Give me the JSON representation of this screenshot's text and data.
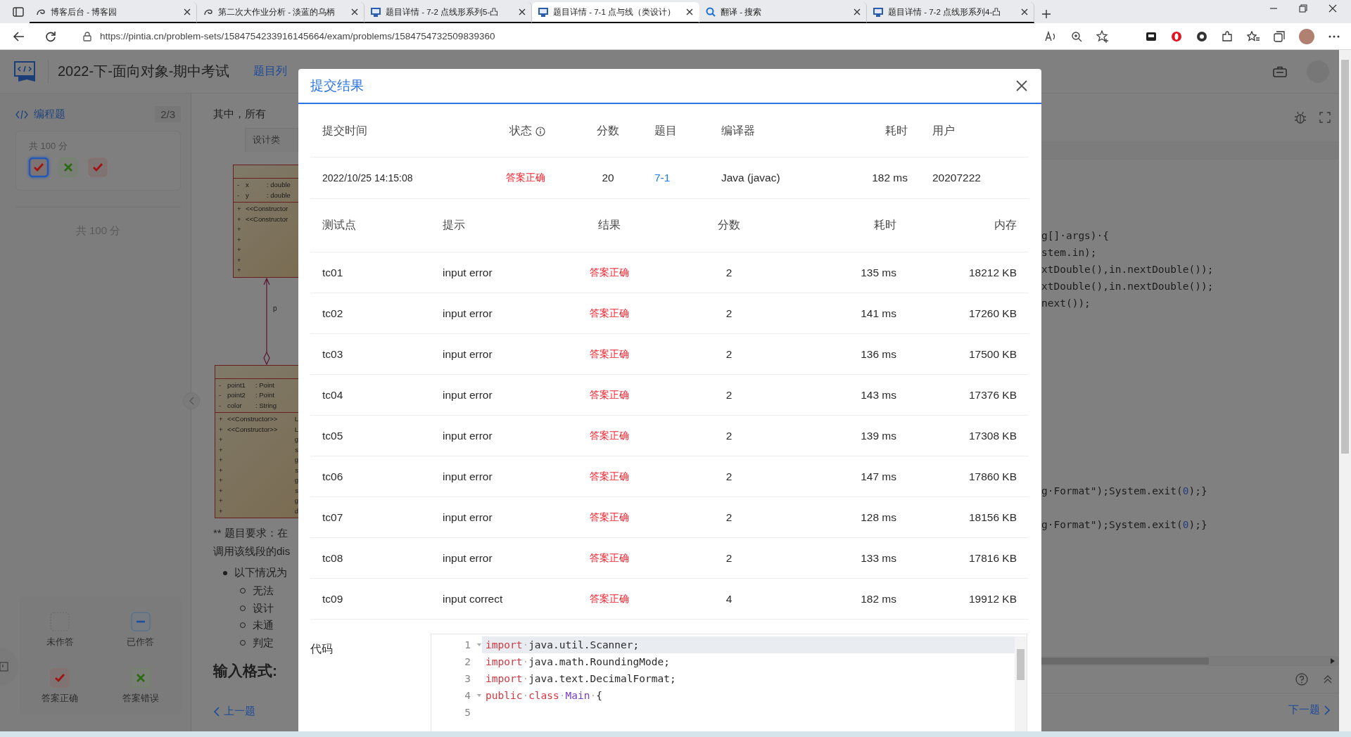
{
  "browser": {
    "tabs": [
      {
        "title": "博客后台 - 博客园",
        "kind": "blog",
        "selected": false
      },
      {
        "title": "第二次大作业分析 - 淡蓝的乌柄",
        "kind": "blog",
        "selected": false
      },
      {
        "title": "题目详情 - 7-2 点线形系列5-凸",
        "kind": "pta",
        "selected": false
      },
      {
        "title": "题目详情 - 7-1 点与线（类设计）",
        "kind": "pta",
        "selected": true
      },
      {
        "title": "翻译 - 搜索",
        "kind": "search",
        "selected": false
      },
      {
        "title": "题目详情 - 7-2 点线形系列4-凸",
        "kind": "pta",
        "selected": false
      }
    ],
    "url": "https://pintia.cn/problem-sets/1584754233916145664/exam/problems/1584754732509839360"
  },
  "header": {
    "title": "2022-下-面向对象-期中考试",
    "nav": [
      {
        "label": "题目列",
        "selected": true
      }
    ]
  },
  "sidebar": {
    "section": "编程题",
    "progress": "2/3",
    "score_card": {
      "total": "共 100 分",
      "answers": [
        {
          "kind": "correct",
          "selected": true
        },
        {
          "kind": "wrong",
          "selected": false
        },
        {
          "kind": "correct",
          "selected": false
        }
      ]
    },
    "total": "共 100 分",
    "legend": [
      {
        "kind": "unanswered",
        "label": "未作答"
      },
      {
        "kind": "answered",
        "label": "已作答"
      },
      {
        "kind": "correct",
        "label": "答案正确"
      },
      {
        "kind": "wrong",
        "label": "答案错误"
      }
    ]
  },
  "problem": {
    "intro": "其中，所有",
    "diagram_tab": "设计类",
    "uml": {
      "class_1": {
        "attributes": [
          {
            "sign": "-",
            "name": "x",
            "type": ": double"
          },
          {
            "sign": "-",
            "name": "y",
            "type": ": double"
          }
        ],
        "methods": [
          {
            "sign": "+",
            "label": "<<Constructor"
          },
          {
            "sign": "+",
            "label": "<<Constructor"
          },
          {
            "sign": "+"
          },
          {
            "sign": "+"
          },
          {
            "sign": "+"
          },
          {
            "sign": "+"
          },
          {
            "sign": "+"
          }
        ]
      },
      "association_label": "p",
      "class_2": {
        "attributes": [
          {
            "sign": "-",
            "name": "point1",
            "type": ": Point"
          },
          {
            "sign": "-",
            "name": "point2",
            "type": ": Point"
          },
          {
            "sign": "-",
            "name": "color",
            "type": ": String"
          }
        ],
        "methods": [
          {
            "sign": "+",
            "label": "<<Constructor>>",
            "column_3": "L"
          },
          {
            "sign": "+",
            "label": "<<Constructor>>",
            "column_3": "L"
          },
          {
            "sign": "+",
            "column_3": "g"
          },
          {
            "sign": "+",
            "column_3": "s"
          },
          {
            "sign": "+",
            "column_3": "g"
          },
          {
            "sign": "+",
            "column_3": "s"
          },
          {
            "sign": "+",
            "column_3": "g"
          },
          {
            "sign": "+",
            "column_3": "s"
          },
          {
            "sign": "+",
            "column_3": "g"
          },
          {
            "sign": "+",
            "column_3": "d"
          }
        ]
      }
    },
    "requirement": [
      "** 题目要求：在",
      "调用该线段的dis"
    ],
    "bullet": "以下情况为",
    "sub_bullets": [
      "无法",
      "设计",
      "未通",
      "判定"
    ],
    "heading": "输入格式:",
    "prev": "上一题"
  },
  "editor": {
    "code_blocks": [
      [
        {
          "tokens": [
            {
              "kind": "plain",
              "text": "g[]·args)·{"
            }
          ]
        },
        {
          "tokens": [
            {
              "kind": "plain",
              "text": "stem.in);"
            }
          ]
        },
        {
          "tokens": [
            {
              "kind": "plain",
              "text": "xtDouble(),in.nextDouble());"
            }
          ]
        },
        {
          "tokens": [
            {
              "kind": "plain",
              "text": "xtDouble(),in.nextDouble());"
            }
          ]
        },
        {
          "tokens": [
            {
              "kind": "plain",
              "text": "next());"
            }
          ]
        }
      ],
      [
        {
          "tokens": [
            {
              "kind": "plain",
              "text": "g·Format\");System.exit("
            },
            {
              "kind": "number",
              "text": "0"
            },
            {
              "kind": "plain",
              "text": ");}"
            }
          ]
        }
      ],
      [
        {
          "tokens": [
            {
              "kind": "plain",
              "text": "g·Format\");System.exit("
            },
            {
              "kind": "number",
              "text": "0"
            },
            {
              "kind": "plain",
              "text": ");}"
            }
          ]
        }
      ]
    ],
    "next": "下一题"
  },
  "modal": {
    "title": "提交结果",
    "summary": {
      "columns": [
        "提交时间",
        "状态",
        "分数",
        "题目",
        "编译器",
        "耗时",
        "用户"
      ],
      "row": {
        "time": "2022/10/25 14:15:08",
        "status": "答案正确",
        "score": "20",
        "problem": "7-1",
        "compiler": "Java (javac)",
        "duration": "182 ms",
        "user": "20207222"
      }
    },
    "tests": {
      "columns": [
        "测试点",
        "提示",
        "结果",
        "分数",
        "耗时",
        "内存"
      ],
      "rows": [
        {
          "case": "tc01",
          "hint": "input error",
          "result": "答案正确",
          "score": "2",
          "time": "135 ms",
          "memory": "18212 KB"
        },
        {
          "case": "tc02",
          "hint": "input error",
          "result": "答案正确",
          "score": "2",
          "time": "141 ms",
          "memory": "17260 KB"
        },
        {
          "case": "tc03",
          "hint": "input error",
          "result": "答案正确",
          "score": "2",
          "time": "136 ms",
          "memory": "17500 KB"
        },
        {
          "case": "tc04",
          "hint": "input error",
          "result": "答案正确",
          "score": "2",
          "time": "143 ms",
          "memory": "17376 KB"
        },
        {
          "case": "tc05",
          "hint": "input error",
          "result": "答案正确",
          "score": "2",
          "time": "139 ms",
          "memory": "17308 KB"
        },
        {
          "case": "tc06",
          "hint": "input error",
          "result": "答案正确",
          "score": "2",
          "time": "147 ms",
          "memory": "17860 KB"
        },
        {
          "case": "tc07",
          "hint": "input error",
          "result": "答案正确",
          "score": "2",
          "time": "128 ms",
          "memory": "18156 KB"
        },
        {
          "case": "tc08",
          "hint": "input error",
          "result": "答案正确",
          "score": "2",
          "time": "133 ms",
          "memory": "17816 KB"
        },
        {
          "case": "tc09",
          "hint": "input correct",
          "result": "答案正确",
          "score": "4",
          "time": "182 ms",
          "memory": "19912 KB"
        }
      ]
    },
    "code_label": "代码",
    "code": [
      {
        "number": "1",
        "fold": true,
        "active": true,
        "tokens": [
          {
            "kind": "keyword",
            "text": "import"
          },
          {
            "kind": "space",
            "text": "·"
          },
          {
            "kind": "plain",
            "text": "java.util.Scanner;"
          }
        ]
      },
      {
        "number": "2",
        "fold": false,
        "active": false,
        "tokens": [
          {
            "kind": "keyword",
            "text": "import"
          },
          {
            "kind": "space",
            "text": "·"
          },
          {
            "kind": "plain",
            "text": "java.math.RoundingMode;"
          }
        ]
      },
      {
        "number": "3",
        "fold": false,
        "active": false,
        "tokens": [
          {
            "kind": "keyword",
            "text": "import"
          },
          {
            "kind": "space",
            "text": "·"
          },
          {
            "kind": "plain",
            "text": "java.text.DecimalFormat;"
          }
        ]
      },
      {
        "number": "4",
        "fold": true,
        "active": false,
        "tokens": [
          {
            "kind": "keyword",
            "text": "public"
          },
          {
            "kind": "space",
            "text": "·"
          },
          {
            "kind": "keyword",
            "text": "class"
          },
          {
            "kind": "space",
            "text": "·"
          },
          {
            "kind": "type",
            "text": "Main"
          },
          {
            "kind": "space",
            "text": "·"
          },
          {
            "kind": "plain",
            "text": "{"
          }
        ]
      },
      {
        "number": "5",
        "fold": false
      }
    ]
  }
}
